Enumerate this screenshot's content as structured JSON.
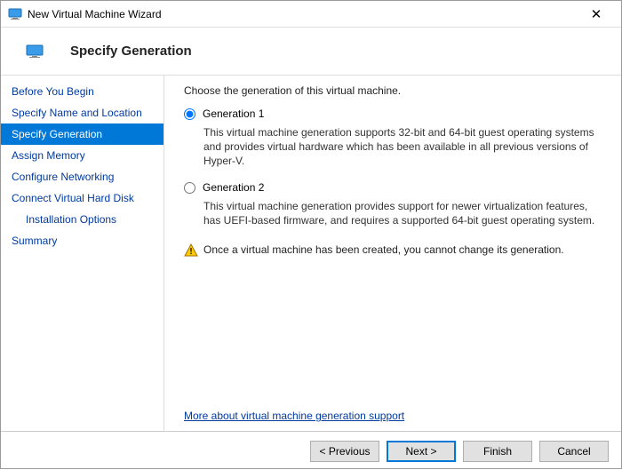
{
  "titlebar": {
    "title": "New Virtual Machine Wizard"
  },
  "header": {
    "title": "Specify Generation"
  },
  "sidebar": {
    "steps": [
      {
        "label": "Before You Begin",
        "active": false,
        "indent": false
      },
      {
        "label": "Specify Name and Location",
        "active": false,
        "indent": false
      },
      {
        "label": "Specify Generation",
        "active": true,
        "indent": false
      },
      {
        "label": "Assign Memory",
        "active": false,
        "indent": false
      },
      {
        "label": "Configure Networking",
        "active": false,
        "indent": false
      },
      {
        "label": "Connect Virtual Hard Disk",
        "active": false,
        "indent": false
      },
      {
        "label": "Installation Options",
        "active": false,
        "indent": true
      },
      {
        "label": "Summary",
        "active": false,
        "indent": false
      }
    ]
  },
  "content": {
    "prompt": "Choose the generation of this virtual machine.",
    "options": [
      {
        "label": "Generation 1",
        "selected": true,
        "desc": "This virtual machine generation supports 32-bit and 64-bit guest operating systems and provides virtual hardware which has been available in all previous versions of Hyper-V."
      },
      {
        "label": "Generation 2",
        "selected": false,
        "desc": "This virtual machine generation provides support for newer virtualization features, has UEFI-based firmware, and requires a supported 64-bit guest operating system."
      }
    ],
    "warning": "Once a virtual machine has been created, you cannot change its generation.",
    "link": "More about virtual machine generation support"
  },
  "footer": {
    "previous": "< Previous",
    "next": "Next >",
    "finish": "Finish",
    "cancel": "Cancel"
  }
}
